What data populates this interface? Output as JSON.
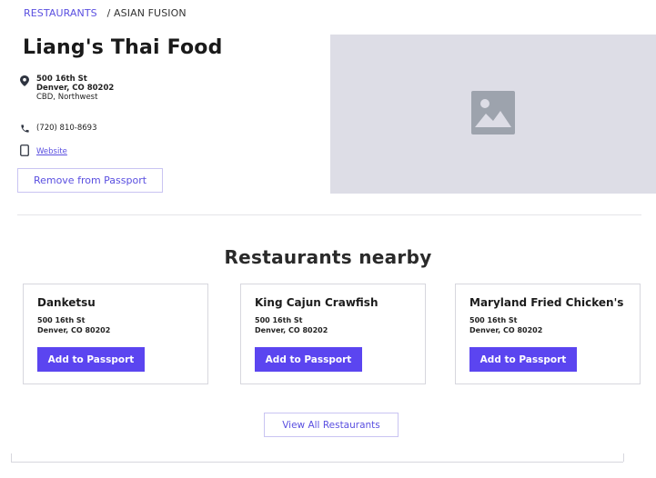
{
  "breadcrumb": {
    "root": "RESTAURANTS",
    "separator": "/",
    "current": "ASIAN FUSION"
  },
  "restaurant": {
    "name": "Liang's Thai Food",
    "address_line1": "500 16th St",
    "address_line2": "Denver, CO 80202",
    "address_line3": "CBD, Northwest",
    "phone": "(720) 810-8693",
    "website_label": "Website",
    "remove_label": "Remove from Passport",
    "photo_icon": "image-placeholder-icon"
  },
  "nearby": {
    "heading": "Restaurants nearby",
    "cards": [
      {
        "name": "Danketsu",
        "address_line1": "500 16th St",
        "address_line2": "Denver, CO 80202",
        "button": "Add to Passport"
      },
      {
        "name": "King Cajun Crawfish",
        "address_line1": "500 16th St",
        "address_line2": "Denver, CO 80202",
        "button": "Add to Passport"
      },
      {
        "name": "Maryland Fried Chicken's",
        "address_line1": "500 16th St",
        "address_line2": "Denver, CO 80202",
        "button": "Add to Passport"
      }
    ],
    "view_all_label": "View All Restaurants"
  },
  "icons": {
    "location": "map-pin-icon",
    "phone": "phone-icon",
    "website": "mobile-device-icon"
  },
  "colors": {
    "accent": "#5a4fe0",
    "primary_button": "#5b45f0",
    "photo_bg": "#dddde6",
    "icon_dark": "#2e3440"
  }
}
